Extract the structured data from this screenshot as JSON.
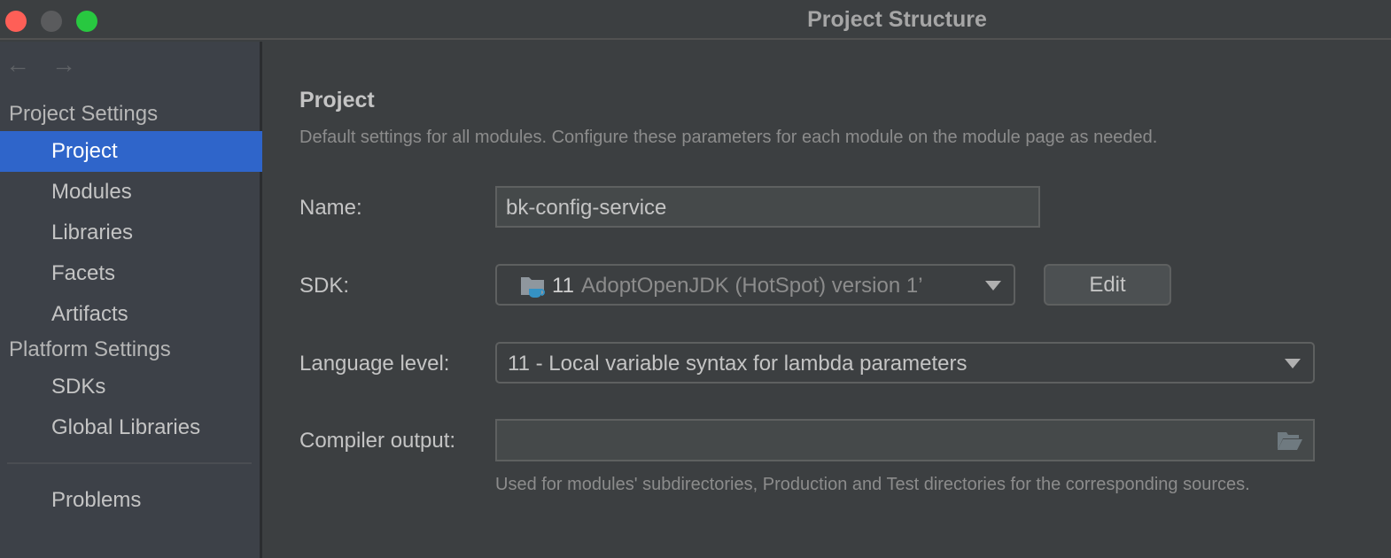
{
  "window": {
    "title": "Project Structure",
    "controls": [
      "close",
      "minimize",
      "maximize"
    ]
  },
  "sidebar": {
    "nav": {
      "back_icon": "arrow-left-icon",
      "forward_icon": "arrow-right-icon"
    },
    "sections": [
      {
        "header": "Project Settings",
        "items": [
          {
            "label": "Project",
            "selected": true
          },
          {
            "label": "Modules"
          },
          {
            "label": "Libraries"
          },
          {
            "label": "Facets"
          },
          {
            "label": "Artifacts"
          }
        ]
      },
      {
        "header": "Platform Settings",
        "items": [
          {
            "label": "SDKs"
          },
          {
            "label": "Global Libraries"
          }
        ]
      }
    ],
    "bottom_items": [
      {
        "label": "Problems"
      }
    ]
  },
  "main": {
    "heading": "Project",
    "description": "Default settings for all modules. Configure these parameters for each module on the module page as needed.",
    "name": {
      "label": "Name:",
      "value": "bk-config-service"
    },
    "sdk": {
      "label": "SDK:",
      "version_number": "11",
      "value": "AdoptOpenJDK (HotSpot) version 1’",
      "icon": "jdk-folder-icon",
      "edit_label": "Edit"
    },
    "language_level": {
      "label": "Language level:",
      "value": "11 - Local variable syntax for lambda parameters"
    },
    "compiler_output": {
      "label": "Compiler output:",
      "value": "",
      "browse_icon": "folder-open-icon",
      "hint": "Used for modules' subdirectories, Production and Test directories for the corresponding sources."
    }
  }
}
